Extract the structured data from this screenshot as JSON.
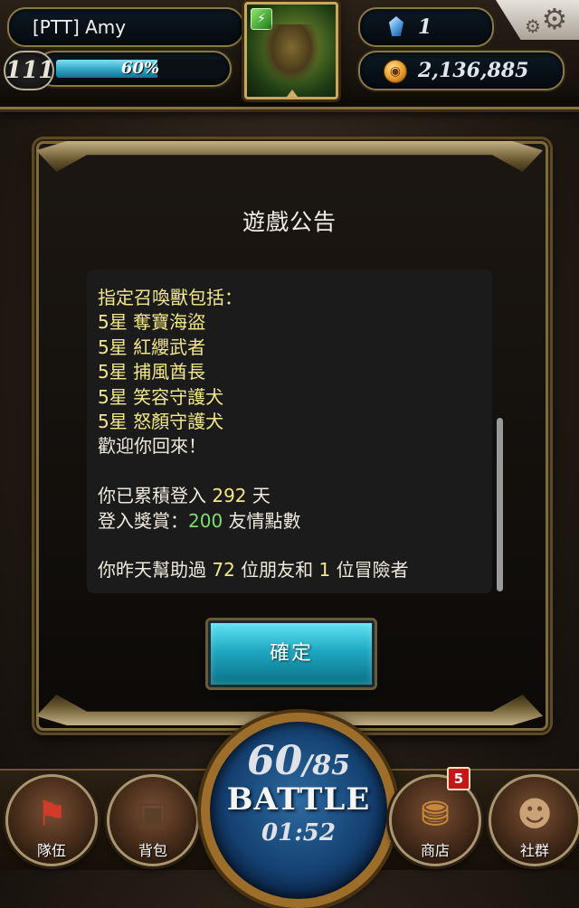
{
  "player": {
    "name": "[PTT]  Amy",
    "level": "111",
    "exp_percent": 60,
    "exp_text": "60%"
  },
  "currency": {
    "gems": "1",
    "coins": "2,136,885"
  },
  "icons": {
    "gem": "diamond-icon",
    "coin": "coin-icon",
    "settings": "gear-icon",
    "team": "flag-icon",
    "bag": "backpack-icon",
    "shop": "treasure-chest-icon",
    "social": "friends-icon"
  },
  "colors": {
    "accent_cyan": "#1fa8c2",
    "highlight_yellow": "#f2e88a",
    "highlight_green": "#7ee06a",
    "badge_red": "#c41818"
  },
  "announcement": {
    "title": "遊戲公告",
    "lines": [
      "指定召喚獸包括：",
      "5星 奪寶海盜",
      "5星 紅纓武者",
      "5星 捕風酋長",
      "5星 笑容守護犬",
      "5星 怒顏守護犬",
      "歡迎你回來！",
      "",
      "你已累積登入",
      "登入獎賞："
    ],
    "login_days": "292",
    "days_unit": "天",
    "reward_amount": "200",
    "reward_unit": "友情點數",
    "help_prefix": "你昨天幫助過",
    "help_friends": "72",
    "help_middle": "位朋友和",
    "help_adventurers": "1",
    "help_suffix": "位冒險者",
    "confirm_label": "確定"
  },
  "battle": {
    "stamina_current": "60",
    "stamina_max": "/85",
    "label": "BATTLE",
    "timer": "01:52"
  },
  "nav": {
    "team": "隊伍",
    "bag": "背包",
    "shop": "商店",
    "shop_badge": "5",
    "social": "社群"
  }
}
